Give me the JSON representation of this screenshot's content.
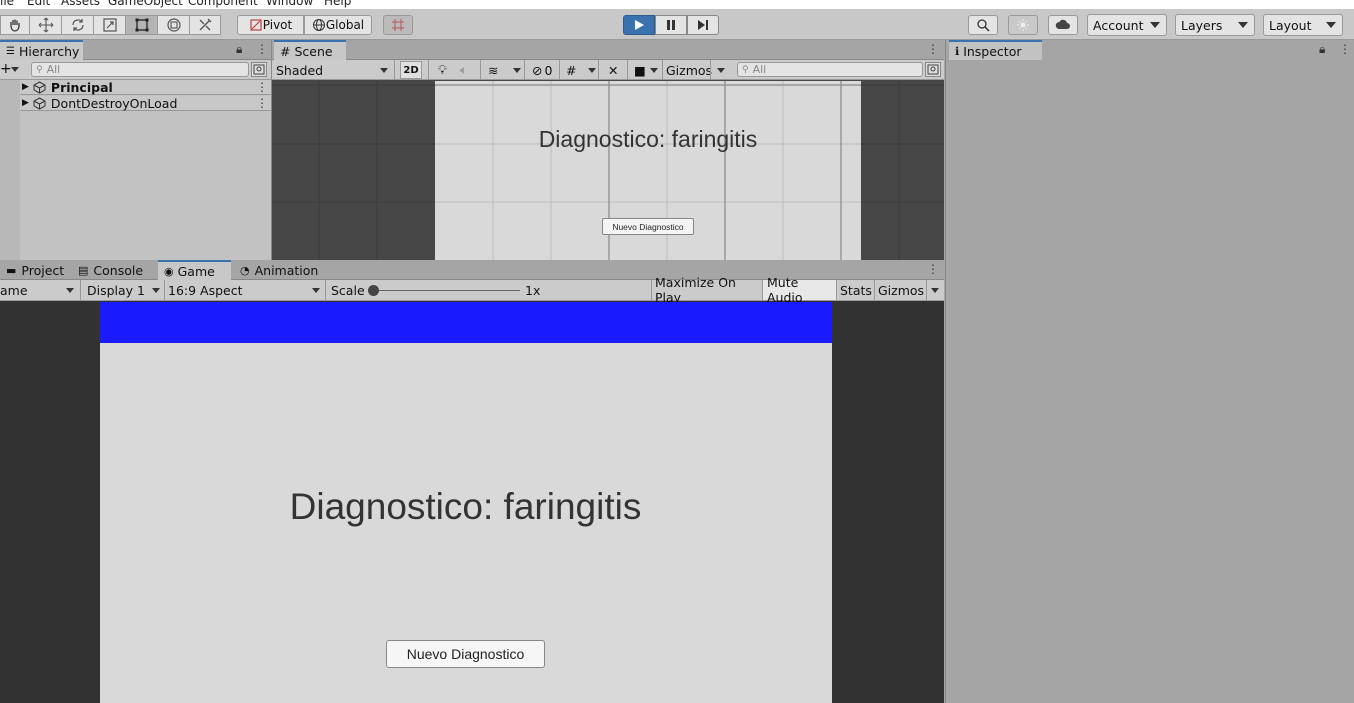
{
  "menubar": {
    "items": [
      "ile",
      "Edit",
      "Assets",
      "GameObject",
      "Component",
      "Window",
      "Help"
    ]
  },
  "toolbar": {
    "tools": [
      "hand-tool",
      "move-tool",
      "rotate-tool",
      "scale-tool",
      "rect-tool",
      "transform-tool",
      "custom-tool"
    ],
    "pivot_label": "Pivot",
    "global_label": "Global",
    "account_label": "Account",
    "layers_label": "Layers",
    "layout_label": "Layout"
  },
  "hierarchy": {
    "tab_label": "Hierarchy",
    "search_placeholder": "All",
    "items": [
      {
        "label": "Principal",
        "bold": true
      },
      {
        "label": "DontDestroyOnLoad",
        "bold": false
      }
    ]
  },
  "scene": {
    "tab_label": "Scene",
    "shading_mode": "Shaded",
    "mode_2d_label": "2D",
    "hidden_count": "0",
    "gizmos_label": "Gizmos",
    "search_placeholder": "All",
    "canvas_text": "Diagnostico: faringitis",
    "canvas_button": "Nuevo Diagnostico"
  },
  "inspector": {
    "tab_label": "Inspector"
  },
  "bottom_tabs": {
    "project": "Project",
    "console": "Console",
    "game": "Game",
    "animation": "Animation"
  },
  "game": {
    "view_dropdown": "ame",
    "display": "Display 1",
    "aspect": "16:9 Aspect",
    "scale_label": "Scale",
    "scale_value": "1x",
    "maximize_label": "Maximize On Play",
    "mute_label": "Mute Audio",
    "stats_label": "Stats",
    "gizmos_label": "Gizmos",
    "diagnosis_text": "Diagnostico: faringitis",
    "new_button_label": "Nuevo Diagnostico",
    "header_color": "#1a1aff"
  },
  "colors": {
    "accent": "#3a72b0",
    "play_active": "#3a72b0"
  }
}
